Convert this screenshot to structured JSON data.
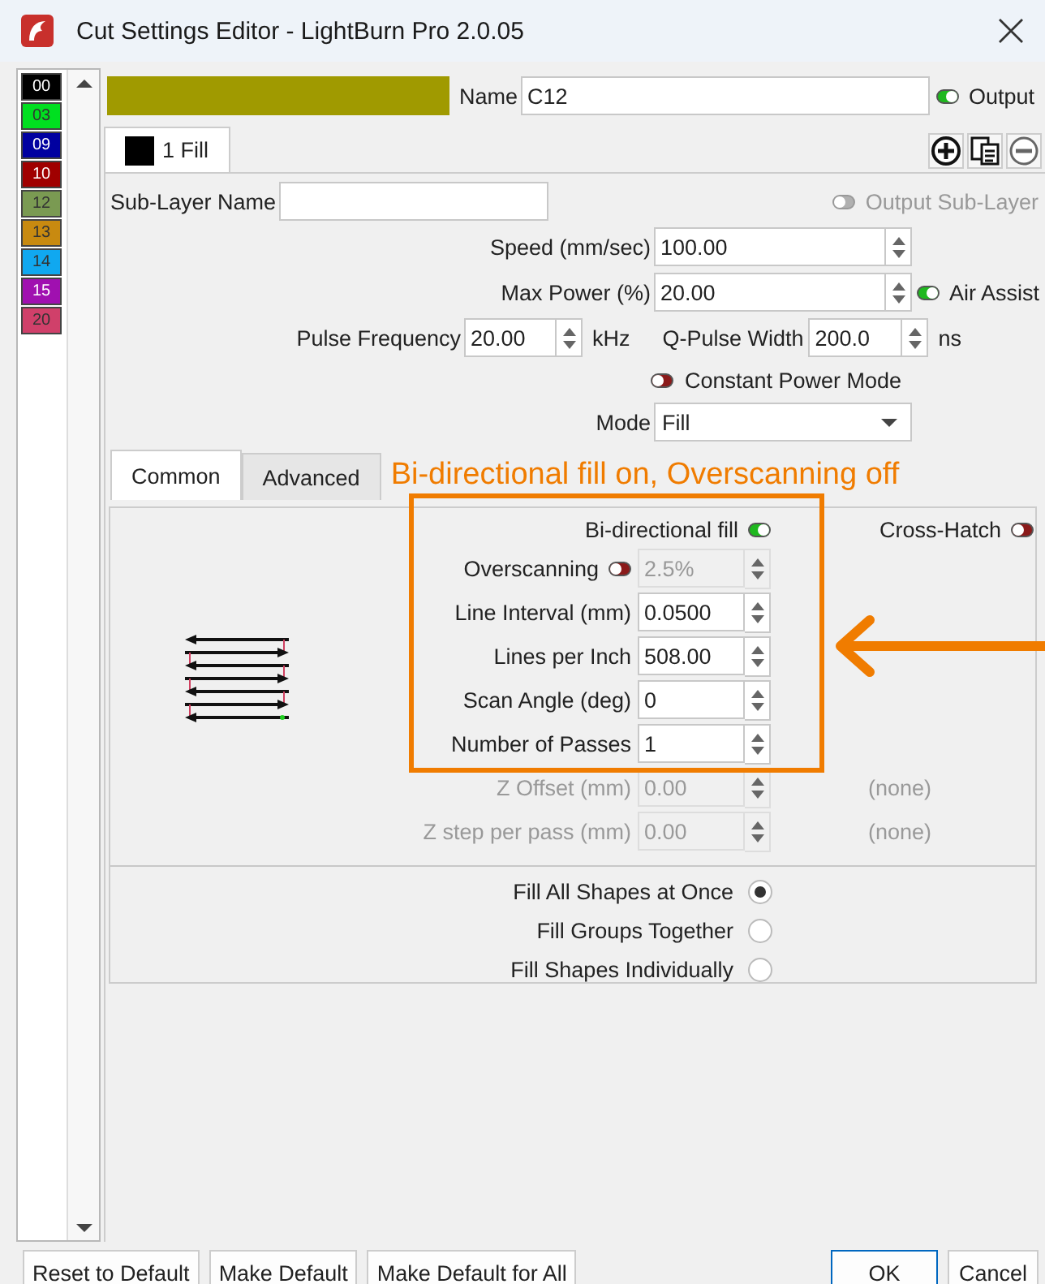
{
  "window": {
    "title": "Cut Settings Editor - LightBurn Pro 2.0.05"
  },
  "layers": [
    {
      "label": "00",
      "color": "#000000"
    },
    {
      "label": "03",
      "color": "#00e020"
    },
    {
      "label": "09",
      "color": "#0000a0"
    },
    {
      "label": "10",
      "color": "#a00000"
    },
    {
      "label": "12",
      "color": "#7a9a52"
    },
    {
      "label": "13",
      "color": "#c88a10"
    },
    {
      "label": "14",
      "color": "#10a8f0"
    },
    {
      "label": "15",
      "color": "#a010b0"
    },
    {
      "label": "20",
      "color": "#d0406a"
    }
  ],
  "layer": {
    "color": "#a09a00",
    "name_label": "Name",
    "name": "C12",
    "output": {
      "label": "Output",
      "on": true
    }
  },
  "sublayers": [
    {
      "label": "1 Fill",
      "color": "#000000",
      "selected": true
    }
  ],
  "sublayer_name": {
    "label": "Sub-Layer Name"
  },
  "output_sublayer": {
    "label": "Output Sub-Layer",
    "on": false,
    "disabled": true
  },
  "speed": {
    "label": "Speed (mm/sec)",
    "value": "100.00"
  },
  "max_power": {
    "label": "Max Power (%)",
    "value": "20.00"
  },
  "air_assist": {
    "label": "Air Assist",
    "on": true
  },
  "pulse_frequency": {
    "label": "Pulse Frequency",
    "value": "20.00",
    "unit": "kHz"
  },
  "q_pulse_width": {
    "label": "Q-Pulse Width",
    "value": "200.0",
    "unit": "ns"
  },
  "constant_power_mode": {
    "label": "Constant Power Mode",
    "on": false
  },
  "mode": {
    "label": "Mode",
    "value": "Fill"
  },
  "tabs": [
    {
      "label": "Common",
      "selected": true
    },
    {
      "label": "Advanced",
      "selected": false
    }
  ],
  "annotation": {
    "text": "Bi-directional fill on, Overscanning off"
  },
  "bidirectional_fill": {
    "label": "Bi-directional fill",
    "on": true
  },
  "cross_hatch": {
    "label": "Cross-Hatch",
    "on": false
  },
  "fields": [
    {
      "kind": "toggled",
      "label": "Overscanning",
      "on": false,
      "value": "2.5%",
      "disabled": true
    },
    {
      "kind": "plain",
      "label": "Line Interval (mm)",
      "value": "0.0500",
      "disabled": false
    },
    {
      "kind": "plain",
      "label": "Lines per Inch",
      "value": "508.00",
      "disabled": false
    },
    {
      "kind": "plain",
      "label": "Scan Angle (deg)",
      "value": "0",
      "disabled": false
    },
    {
      "kind": "plain",
      "label": "Number of Passes",
      "value": "1",
      "disabled": false
    },
    {
      "kind": "plain",
      "label": "Z Offset (mm)",
      "value": "0.00",
      "disabled": true,
      "note": "(none)"
    },
    {
      "kind": "plain",
      "label": "Z step per pass (mm)",
      "value": "0.00",
      "disabled": true,
      "note": "(none)"
    }
  ],
  "fill_order": [
    {
      "label": "Fill All Shapes at Once",
      "selected": true
    },
    {
      "label": "Fill Groups Together",
      "selected": false
    },
    {
      "label": "Fill Shapes Individually",
      "selected": false
    }
  ],
  "buttons": [
    {
      "label": "Reset to Default",
      "default": false
    },
    {
      "label": "Make Default",
      "default": false
    },
    {
      "label": "Make Default for All",
      "default": false
    },
    {
      "label": "OK",
      "default": true
    },
    {
      "label": "Cancel",
      "default": false
    }
  ]
}
